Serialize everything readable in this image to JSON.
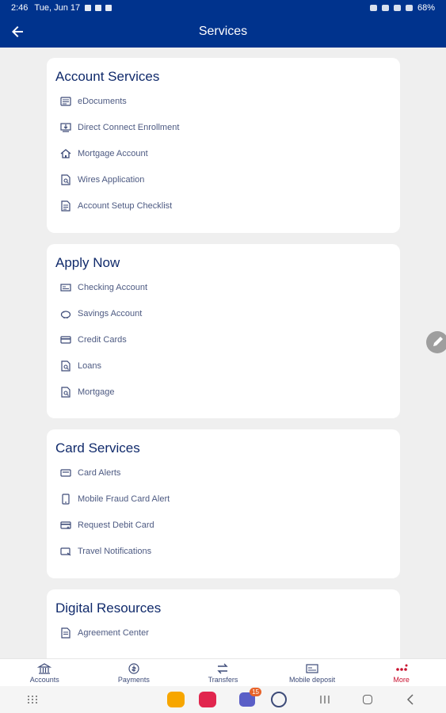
{
  "status_bar": {
    "time": "2:46",
    "date": "Tue, Jun 17",
    "battery": "68%"
  },
  "header": {
    "title": "Services"
  },
  "sections": [
    {
      "title": "Account Services",
      "items": [
        {
          "label": "eDocuments",
          "icon": "document-icon"
        },
        {
          "label": "Direct Connect Enrollment",
          "icon": "download-computer-icon"
        },
        {
          "label": "Mortgage Account",
          "icon": "home-icon"
        },
        {
          "label": "Wires Application",
          "icon": "file-search-icon"
        },
        {
          "label": "Account Setup Checklist",
          "icon": "checklist-icon"
        }
      ]
    },
    {
      "title": "Apply Now",
      "items": [
        {
          "label": "Checking Account",
          "icon": "checkbook-icon"
        },
        {
          "label": "Savings Account",
          "icon": "piggy-bank-icon"
        },
        {
          "label": "Credit Cards",
          "icon": "credit-card-icon"
        },
        {
          "label": "Loans",
          "icon": "file-search-icon"
        },
        {
          "label": "Mortgage",
          "icon": "file-search-icon"
        }
      ]
    },
    {
      "title": "Card Services",
      "items": [
        {
          "label": "Card Alerts",
          "icon": "card-alert-icon"
        },
        {
          "label": "Mobile Fraud Card Alert",
          "icon": "mobile-icon"
        },
        {
          "label": "Request Debit Card",
          "icon": "card-add-icon"
        },
        {
          "label": "Travel Notifications",
          "icon": "card-travel-icon"
        }
      ]
    },
    {
      "title": "Digital Resources",
      "items": [
        {
          "label": "Agreement Center",
          "icon": "agreement-icon"
        }
      ]
    }
  ],
  "bottom_nav": [
    {
      "label": "Accounts",
      "icon": "bank-icon"
    },
    {
      "label": "Payments",
      "icon": "payments-icon"
    },
    {
      "label": "Transfers",
      "icon": "transfer-arrows-icon"
    },
    {
      "label": "Mobile deposit",
      "icon": "check-deposit-icon"
    },
    {
      "label": "More",
      "icon": "more-dots-icon"
    }
  ],
  "system_nav": {
    "teams_badge": "15"
  },
  "colors": {
    "primary": "#00338d",
    "accent_red": "#c8102e",
    "text_title": "#102a6b",
    "text_item": "#4d5a82"
  }
}
